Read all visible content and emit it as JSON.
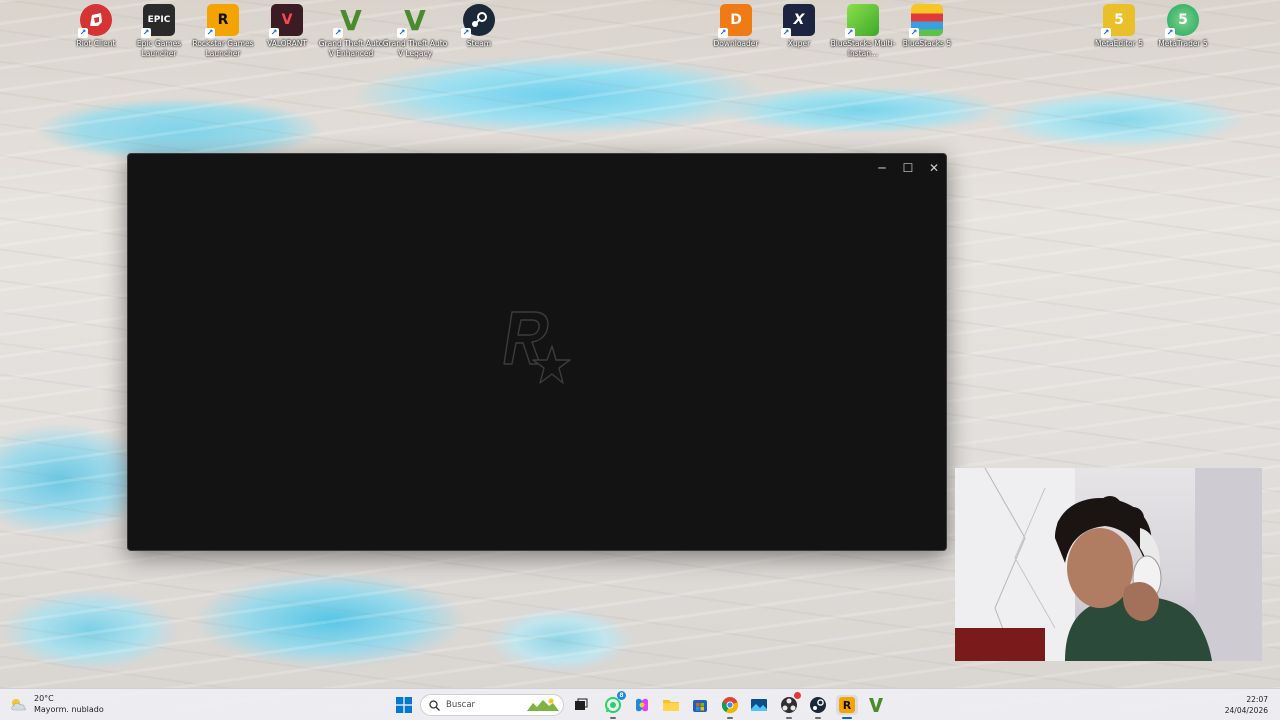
{
  "desktop": {
    "icons_left": [
      {
        "label": "Riot Client",
        "glyph": "R",
        "color": "#d63335",
        "icon": "riot-client-icon"
      },
      {
        "label": "Epic Games Launcher",
        "glyph": "EPIC",
        "color": "#2a2a2a",
        "icon": "epic-games-icon"
      },
      {
        "label": "Rockstar Games Launcher",
        "glyph": "R",
        "color": "#f5a300",
        "icon": "rockstar-icon"
      },
      {
        "label": "VALORANT",
        "glyph": "V",
        "color": "#3b1c24",
        "icon": "valorant-icon"
      },
      {
        "label": "Grand Theft Auto V Enhanced",
        "glyph": "V",
        "color": "#4c8a2e",
        "icon": "gta-v-icon"
      },
      {
        "label": "Grand Theft Auto V Legacy",
        "glyph": "V",
        "color": "#4c8a2e",
        "icon": "gta-v-icon"
      },
      {
        "label": "Steam",
        "glyph": "S",
        "color": "#1b2838",
        "icon": "steam-icon"
      }
    ],
    "icons_right": [
      {
        "label": "Downloader",
        "glyph": "D",
        "color": "#f07b14",
        "icon": "downloader-icon"
      },
      {
        "label": "Xuper",
        "glyph": "X",
        "color": "#1d2440",
        "icon": "xuper-icon"
      },
      {
        "label": "BlueStacks Multi-Instan...",
        "glyph": "",
        "color": "#6fca2a",
        "icon": "bluestacks-multi-icon"
      },
      {
        "label": "BlueStacks 5",
        "glyph": "",
        "color": "#39a0e0",
        "icon": "bluestacks-icon"
      },
      {
        "label": "MetaEditor 5",
        "glyph": "5",
        "color": "#e9c02a",
        "icon": "metaeditor-icon"
      },
      {
        "label": "MetaTrader 5",
        "glyph": "5",
        "color": "#3bb46c",
        "icon": "metatrader-icon"
      }
    ]
  },
  "window": {
    "minimize_symbol": "─",
    "maximize_symbol": "☐",
    "close_symbol": "✕",
    "logo": "rockstar-logo"
  },
  "taskbar": {
    "weather": {
      "temp": "20°C",
      "condition": "Mayorm. nublado"
    },
    "search_placeholder": "Buscar",
    "clock": {
      "time": "22:07",
      "date": "24/04/2026"
    },
    "whatsapp_badge": "8",
    "apps": [
      {
        "icon": "start-icon"
      },
      {
        "icon": "task-view-icon"
      },
      {
        "icon": "whatsapp-icon"
      },
      {
        "icon": "copilot-icon"
      },
      {
        "icon": "file-explorer-icon"
      },
      {
        "icon": "store-icon"
      },
      {
        "icon": "chrome-icon"
      },
      {
        "icon": "photos-icon"
      },
      {
        "icon": "obs-icon"
      },
      {
        "icon": "steam-icon"
      },
      {
        "icon": "rockstar-icon"
      },
      {
        "icon": "gta-v-icon"
      }
    ]
  },
  "colors": {
    "window_bg": "#131313",
    "taskbar_bg": "#eeeef2",
    "accent": "#0067c0"
  }
}
